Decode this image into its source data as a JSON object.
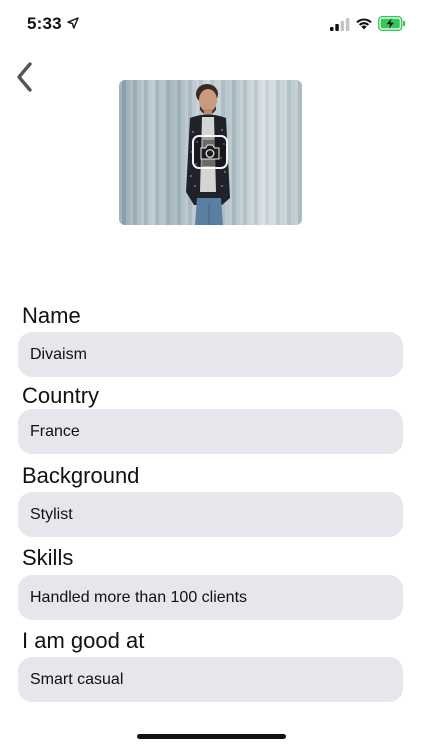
{
  "status_bar": {
    "time": "5:33"
  },
  "form": {
    "fields": [
      {
        "label": "Name",
        "value": "Divaism"
      },
      {
        "label": "Country",
        "value": "France"
      },
      {
        "label": "Background",
        "value": "Stylist"
      },
      {
        "label": "Skills",
        "value": "Handled more than 100 clients"
      },
      {
        "label": "I am good at",
        "value": "Smart casual"
      }
    ]
  },
  "icons": {
    "back": "chevron-left-icon",
    "camera": "camera-icon",
    "location": "location-arrow-icon",
    "signal": "cellular-signal-icon",
    "wifi": "wifi-icon",
    "battery": "battery-charging-icon"
  },
  "colors": {
    "battery_fill": "#34c759",
    "field_background": "#e6e6ec",
    "back_chevron": "#555555"
  }
}
